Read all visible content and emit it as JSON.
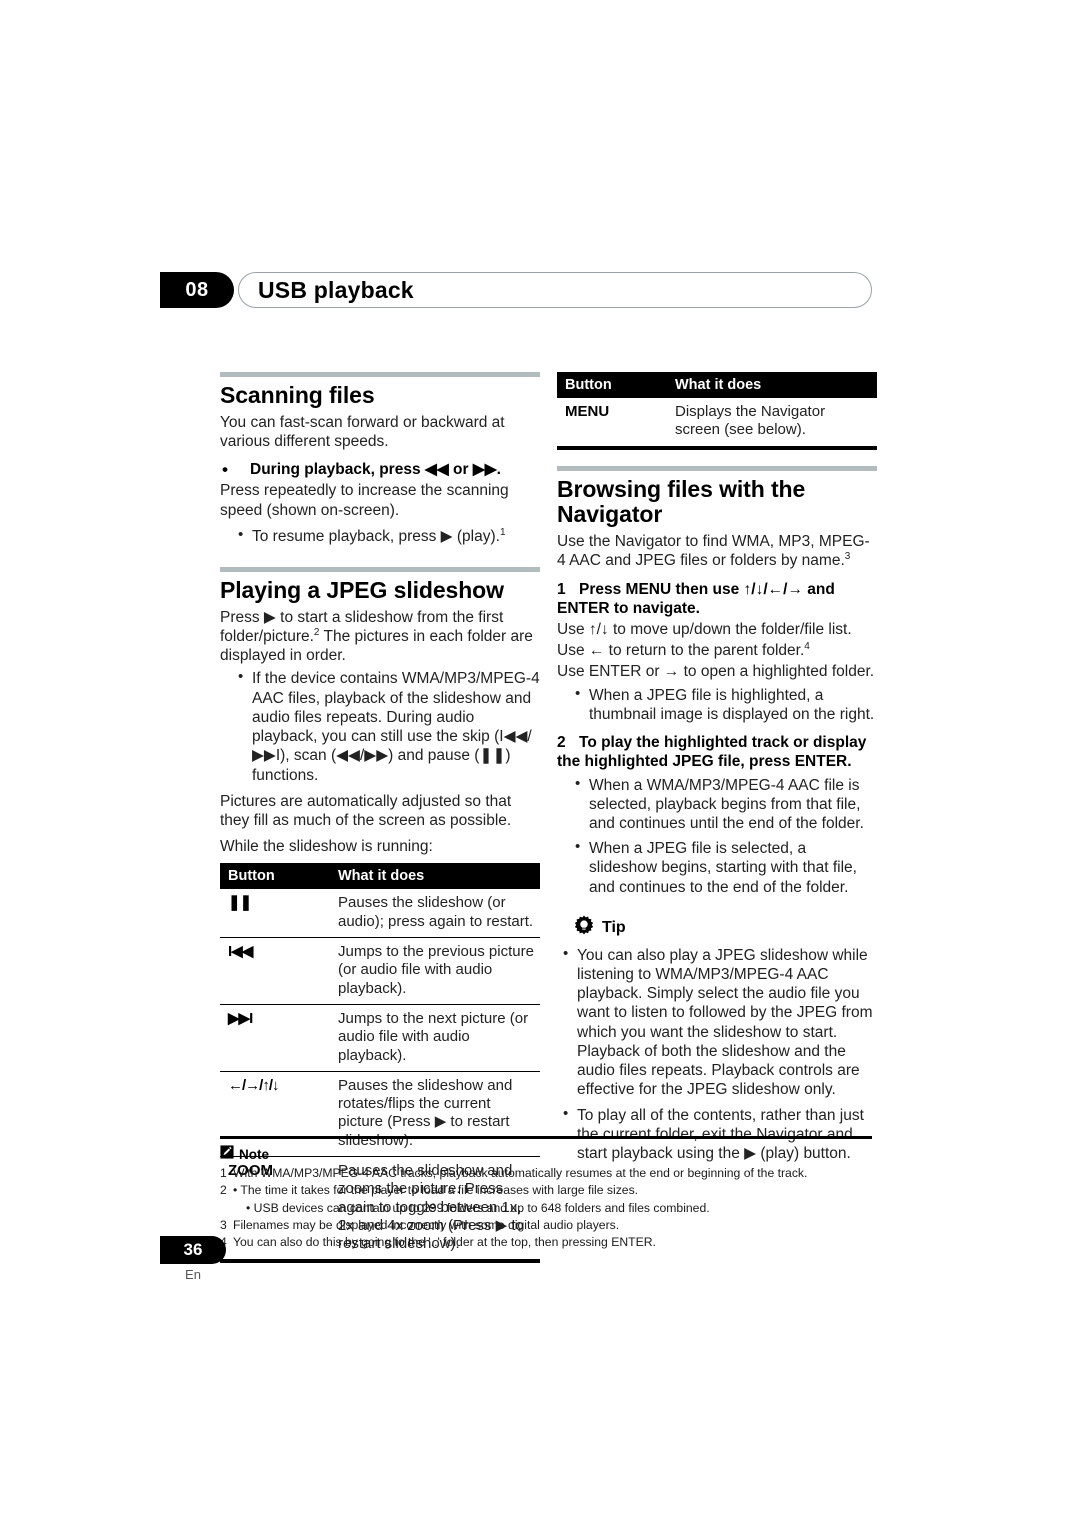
{
  "header": {
    "chapter_number": "08",
    "chapter_title": "USB playback"
  },
  "left_column": {
    "section1": {
      "heading": "Scanning files",
      "intro": "You can fast-scan forward or backward at various different speeds.",
      "bullet_bold": "During playback, press ◀◀ or ▶▶.",
      "after_bullet": "Press repeatedly to increase the scanning speed (shown on-screen).",
      "sub_bullet": "To resume playback, press ▶ (play).",
      "sub_bullet_note": "1"
    },
    "section2": {
      "heading": "Playing a JPEG slideshow",
      "intro_a": "Press ▶ to start a slideshow from the first folder/picture.",
      "intro_a_note": "2",
      "intro_b": "The pictures in each folder are displayed in order.",
      "bullets": [
        "If the device contains WMA/MP3/MPEG-4 AAC files, playback of the slideshow and audio files repeats. During audio playback, you can still use the skip (I◀◀/▶▶I), scan (◀◀/▶▶) and pause (❚❚) functions."
      ],
      "para_after": "Pictures are automatically adjusted so that they fill as much of the screen as possible.",
      "para_running": "While the slideshow is running:",
      "table": {
        "headers": [
          "Button",
          "What it does"
        ],
        "rows": [
          {
            "button": "❚❚",
            "desc": "Pauses the slideshow (or audio); press again to restart."
          },
          {
            "button": "I◀◀",
            "desc": "Jumps to the previous picture (or audio file with audio playback)."
          },
          {
            "button": "▶▶I",
            "desc": "Jumps to the next picture (or audio file with audio playback)."
          },
          {
            "button": "←/→/↑/↓",
            "desc": "Pauses the slideshow and rotates/flips the current picture (Press ▶ to restart slideshow)."
          },
          {
            "button": "ZOOM",
            "desc": "Pauses the slideshow and zooms the picture. Press again to toggle between 1x, 2x and 4x zoom (Press ▶ to restart slideshow)."
          }
        ]
      }
    }
  },
  "right_column": {
    "table_top": {
      "headers": [
        "Button",
        "What it does"
      ],
      "rows": [
        {
          "button": "MENU",
          "desc": "Displays the Navigator screen (see below)."
        }
      ]
    },
    "section3": {
      "heading": "Browsing files with the Navigator",
      "intro": "Use the Navigator to find WMA, MP3, MPEG-4 AAC and JPEG files or folders by name.",
      "intro_note": "3",
      "step1": {
        "number": "1",
        "text": "Press MENU then use ↑/↓/←/→ and ENTER to navigate."
      },
      "step1_lines": [
        {
          "text": "Use ↑/↓ to move up/down the folder/file list.",
          "note": ""
        },
        {
          "text": "Use ← to return to the parent folder.",
          "note": "4"
        },
        {
          "text": "Use ENTER or → to open a highlighted folder.",
          "note": ""
        }
      ],
      "step1_bullets": [
        "When a JPEG file is highlighted, a thumbnail image is displayed on the right."
      ],
      "step2": {
        "number": "2",
        "text": "To play the highlighted track or display the highlighted JPEG file, press ENTER."
      },
      "step2_bullets": [
        "When a WMA/MP3/MPEG-4 AAC file is selected, playback begins from that file, and continues until the end of the folder.",
        "When a JPEG file is selected, a slideshow begins, starting with that file, and continues to the end of the folder."
      ]
    },
    "tip": {
      "label": "Tip",
      "bullets": [
        "You can also play a JPEG slideshow while listening to WMA/MP3/MPEG-4 AAC playback. Simply select the audio file you want to listen to followed by the JPEG from which you want the slideshow to start. Playback of both the slideshow and the audio files repeats. Playback controls are effective for the JPEG slideshow only.",
        "To play all of the contents, rather than just the current folder, exit the Navigator and start playback using the ▶ (play) button."
      ]
    }
  },
  "notes": {
    "label": "Note",
    "items": [
      {
        "num": "1",
        "text": "With WMA/MP3/MPEG-4 AAC tracks, playback automatically resumes at the end or beginning of the track.",
        "sub": false
      },
      {
        "num": "2",
        "text": "• The time it takes for the player to load a file increases with large file sizes.",
        "sub": false
      },
      {
        "num": "",
        "text": "• USB devices can contain up to 299 folders and up to 648 folders and files combined.",
        "sub": true
      },
      {
        "num": "3",
        "text": "Filenames may be displayed incorrectly with some digital audio players.",
        "sub": false
      },
      {
        "num": "4",
        "text": "You can also do this by going to the '..' folder at the top, then pressing ENTER.",
        "sub": false
      }
    ]
  },
  "folio": {
    "page_number": "36",
    "language": "En"
  },
  "colors": {
    "rule_gray": "#b2bcbe",
    "ink": "#000000",
    "body_text": "#222222"
  }
}
